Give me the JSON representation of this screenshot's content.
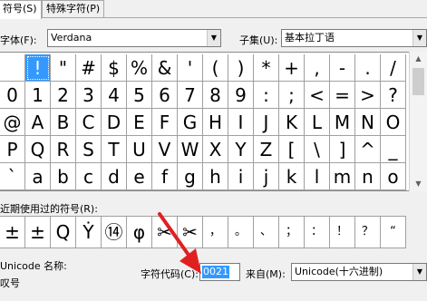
{
  "tabs": [
    {
      "label": "符号(S)",
      "active": true
    },
    {
      "label": "特殊字符(P)",
      "active": false
    }
  ],
  "font": {
    "label": "字体(F):",
    "value": "Verdana"
  },
  "subset": {
    "label": "子集(U):",
    "value": "基本拉丁语"
  },
  "grid_rows": [
    [
      "!",
      "\"",
      "#",
      "$",
      "%",
      "&",
      "'",
      "(",
      ")",
      "*",
      "+",
      ",",
      "-",
      ".",
      "/"
    ],
    [
      "0",
      "1",
      "2",
      "3",
      "4",
      "5",
      "6",
      "7",
      "8",
      "9",
      ":",
      ";",
      "<",
      "=",
      ">",
      "?"
    ],
    [
      "@",
      "A",
      "B",
      "C",
      "D",
      "E",
      "F",
      "G",
      "H",
      "I",
      "J",
      "K",
      "L",
      "M",
      "N",
      "O"
    ],
    [
      "P",
      "Q",
      "R",
      "S",
      "T",
      "U",
      "V",
      "W",
      "X",
      "Y",
      "Z",
      "[",
      "\\",
      "]",
      "^",
      "_"
    ],
    [
      "`",
      "a",
      "b",
      "c",
      "d",
      "e",
      "f",
      "g",
      "h",
      "i",
      "j",
      "k",
      "l",
      "m",
      "n",
      "o"
    ]
  ],
  "selected_symbol": "!",
  "recent": {
    "label": "近期使用过的符号(R):",
    "symbols": [
      "±",
      "±",
      "Q",
      "Ẏ",
      "⑭",
      "φ",
      "✂",
      "✂",
      "，",
      "。",
      "、",
      "；",
      "：",
      "！",
      "？",
      "“"
    ]
  },
  "unicode_name": {
    "label": "Unicode 名称:",
    "value": "叹号"
  },
  "char_code": {
    "label": "字符代码(C):",
    "value": "0021"
  },
  "from": {
    "label": "来自(M):",
    "value": "Unicode(十六进制)"
  },
  "colors": {
    "selection": "#3399ff",
    "annotation_arrow": "#e02020"
  }
}
